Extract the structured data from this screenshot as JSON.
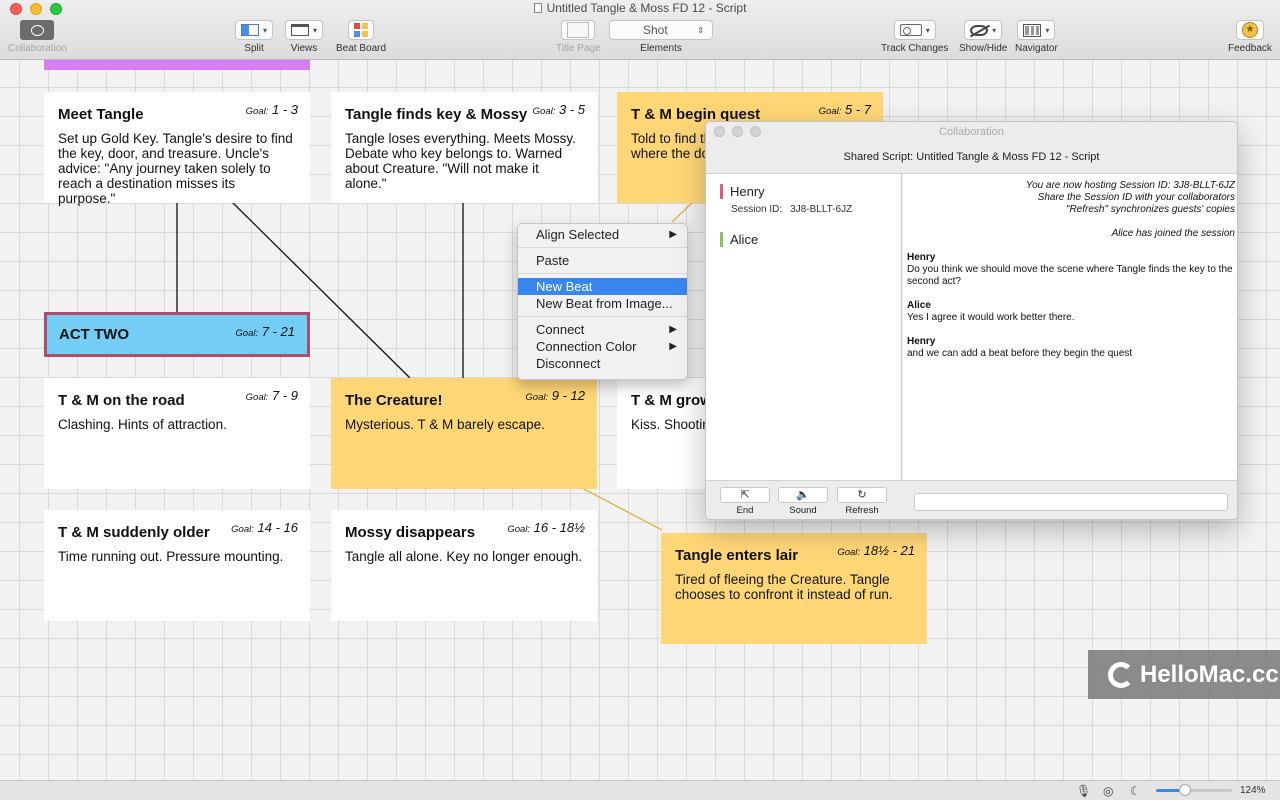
{
  "window": {
    "title": "Untitled Tangle & Moss FD 12 - Script"
  },
  "toolbar": {
    "collaboration": "Collaboration",
    "split": "Split",
    "views": "Views",
    "beat_board": "Beat Board",
    "title_page": "Title Page",
    "elements_value": "Shot",
    "elements": "Elements",
    "track_changes": "Track Changes",
    "show_hide": "Show/Hide",
    "navigator": "Navigator",
    "feedback": "Feedback"
  },
  "colors": {
    "act_two": "#74cdf4",
    "beat_yellow": "#ffd777",
    "strip": "#d77ff0",
    "highlight": "#3a86ef"
  },
  "cards": [
    {
      "title": "Meet Tangle",
      "goal_label": "Goal:",
      "goal": "1 - 3",
      "body": "Set up Gold Key. Tangle's desire to find the key, door, and treasure. Uncle's advice: \"Any journey taken solely to reach a destination misses its purpose.\""
    },
    {
      "title": "Tangle finds key & Mossy",
      "goal_label": "Goal:",
      "goal": "3 - 5",
      "body": "Tangle loses everything. Meets Mossy. Debate who key belongs to. Warned about Creature. \"Will not make it alone.\""
    },
    {
      "title": "T & M begin quest",
      "goal_label": "Goal:",
      "goal": "5 - 7",
      "body": "Told to find th where the do"
    },
    {
      "title": "ACT TWO",
      "goal_label": "Goal:",
      "goal": "7 - 21",
      "body": ""
    },
    {
      "title": "T & M on the road",
      "goal_label": "Goal:",
      "goal": "7 - 9",
      "body": "Clashing. Hints of attraction."
    },
    {
      "title": "The Creature!",
      "goal_label": "Goal:",
      "goal": "9 - 12",
      "body": "Mysterious. T & M barely escape."
    },
    {
      "title": "T & M grow",
      "goal_label": "",
      "goal": "",
      "body": "Kiss. Shootin"
    },
    {
      "title": "T & M suddenly older",
      "goal_label": "Goal:",
      "goal": "14 - 16",
      "body": "Time running out. Pressure mounting."
    },
    {
      "title": "Mossy disappears",
      "goal_label": "Goal:",
      "goal": "16 - 18½",
      "body": "Tangle all alone. Key no longer enough."
    },
    {
      "title": "Tangle enters lair",
      "goal_label": "Goal:",
      "goal": "18½ - 21",
      "body": "Tired of fleeing the Creature. Tangle chooses to confront it instead of run."
    }
  ],
  "context_menu": {
    "align_selected": "Align Selected",
    "paste": "Paste",
    "new_beat": "New Beat",
    "new_beat_from_image": "New Beat from Image...",
    "connect": "Connect",
    "connection_color": "Connection Color",
    "disconnect": "Disconnect"
  },
  "collab": {
    "title": "Collaboration",
    "subtitle": "Shared Script: Untitled Tangle & Moss FD 12 - Script",
    "users": [
      {
        "name": "Henry"
      },
      {
        "name": "Alice"
      }
    ],
    "session_label": "Session ID:",
    "session_id": "3J8-BLLT-6JZ",
    "system": [
      "You are now hosting Session ID: 3J8-BLLT-6JZ",
      "Share the Session ID with your collaborators",
      "\"Refresh\" synchronizes guests' copies"
    ],
    "joined": "Alice has joined the session",
    "messages": [
      {
        "author": "Henry",
        "text": "Do you think we should move the scene where Tangle finds the key to the second act?"
      },
      {
        "author": "Alice",
        "text": "Yes I agree it would work better there."
      },
      {
        "author": "Henry",
        "text": "and we can add a beat before they begin the quest"
      }
    ],
    "buttons": {
      "end": "End",
      "sound": "Sound",
      "refresh": "Refresh"
    }
  },
  "watermark": "HelloMac.cc",
  "status": {
    "zoom": "124%",
    "zoom_fraction": 0.38
  }
}
